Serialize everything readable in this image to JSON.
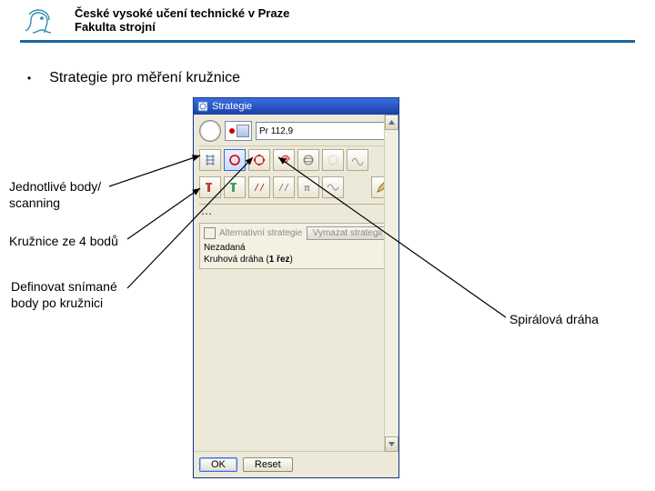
{
  "header": {
    "line1": "České vysoké učení technické v Praze",
    "line2": "Fakulta strojní"
  },
  "bullet_title": "Strategie pro měření kružnice",
  "annotations": {
    "points_scanning_l1": "Jednotlivé body/",
    "points_scanning_l2": "scanning",
    "circle4": "Kružnice ze 4 bodů",
    "define_l1": "Definovat snímané",
    "define_l2": "body po kružnici",
    "spiral": "Spirálová dráha"
  },
  "dialog": {
    "title": "Strategie",
    "pr_field": "Pr 112,9",
    "alt_strategy_checkbox": "Alternativní strategie",
    "reset_button": "Vymazat strategii",
    "list_line1": "Nezadaná",
    "list_line2_a": "Kruhová dráha (",
    "list_line2_b": "1 řez",
    "list_line2_c": ")",
    "ok": "OK",
    "reset": "Reset"
  },
  "icons": {
    "logo": "cvut-lion-logo",
    "titlebar": "app-icon",
    "tools_row1": [
      "grid-icon",
      "red-circle-icon",
      "node-circle-icon",
      "spiral-icon",
      "sphere-icon",
      "dots-circle-icon",
      "wave-icon"
    ],
    "tools_row2": [
      "t1-icon",
      "t2-icon",
      "nudge-icon",
      "nudge2-icon",
      "pi-icon",
      "wave2-icon",
      "pencil-icon"
    ]
  },
  "colors": {
    "accent": "#1a67a0",
    "titlebar_top": "#3a6de0",
    "titlebar_bottom": "#1a3fa8",
    "panel": "#ece9d8"
  }
}
